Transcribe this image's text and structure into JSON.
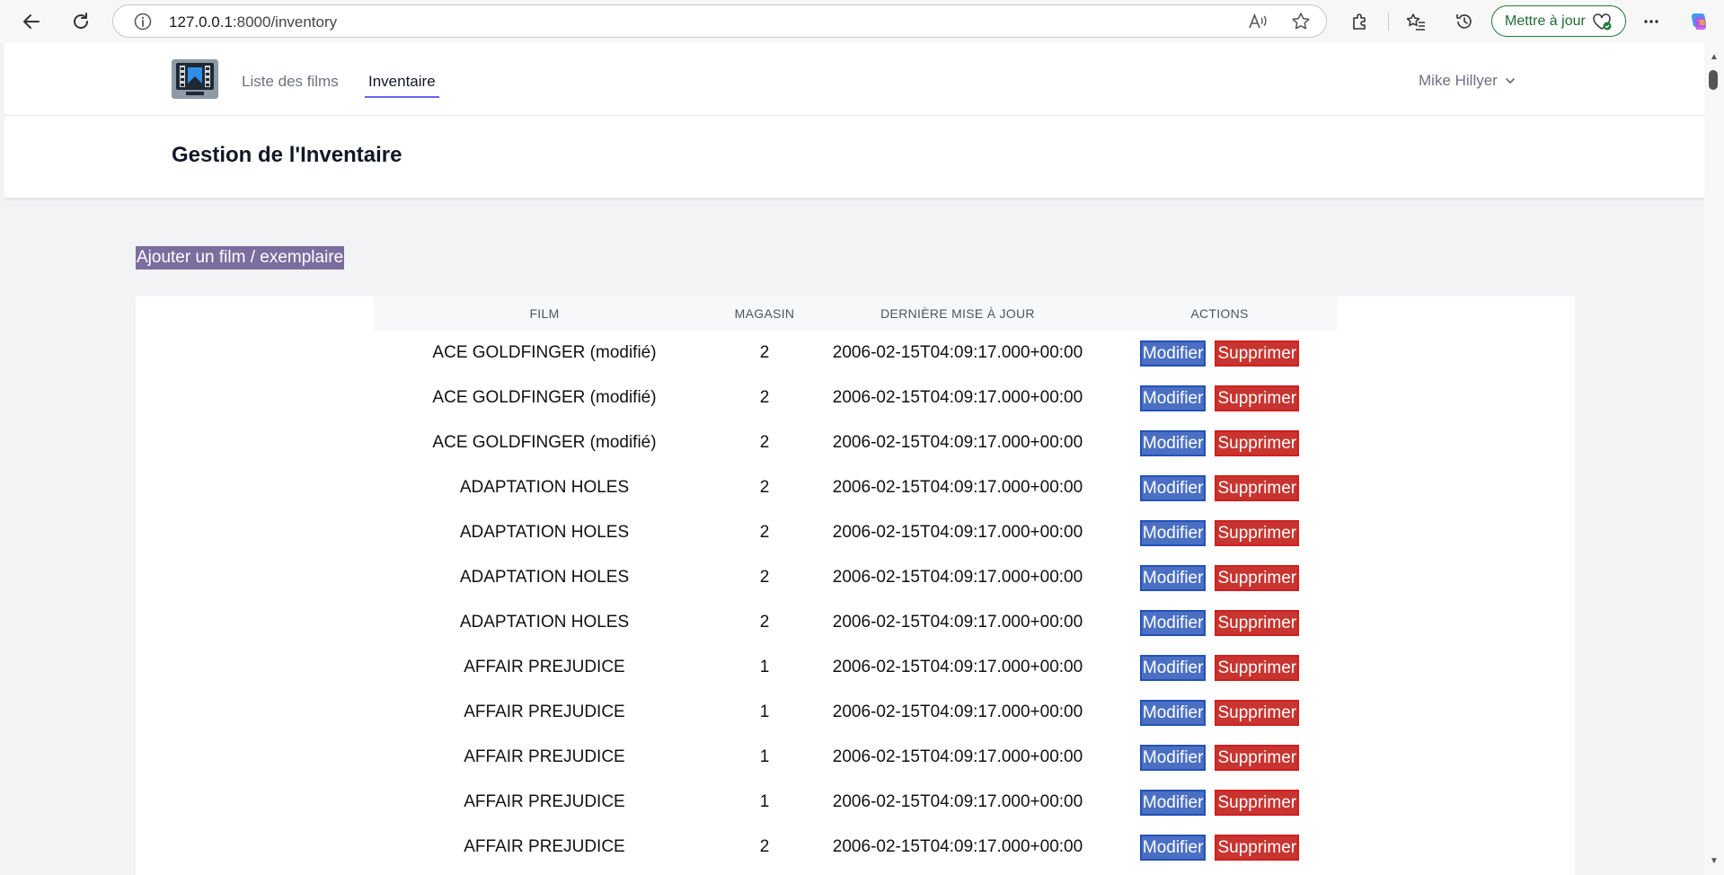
{
  "browser": {
    "url_host": "127.0.0.1",
    "url_path": ":8000/inventory",
    "update_label": "Mettre à jour"
  },
  "nav": {
    "links": [
      {
        "label": "Liste des films"
      },
      {
        "label": "Inventaire"
      }
    ],
    "user": "Mike Hillyer"
  },
  "page": {
    "title": "Gestion de l'Inventaire",
    "add_link": "Ajouter un film / exemplaire"
  },
  "table": {
    "headers": [
      "FILM",
      "MAGASIN",
      "DERNIÈRE MISE À JOUR",
      "ACTIONS"
    ],
    "edit_label": "Modifier",
    "delete_label": "Supprimer",
    "rows": [
      {
        "film": "ACE GOLDFINGER (modifié)",
        "store": "2",
        "updated": "2006-02-15T04:09:17.000+00:00"
      },
      {
        "film": "ACE GOLDFINGER (modifié)",
        "store": "2",
        "updated": "2006-02-15T04:09:17.000+00:00"
      },
      {
        "film": "ACE GOLDFINGER (modifié)",
        "store": "2",
        "updated": "2006-02-15T04:09:17.000+00:00"
      },
      {
        "film": "ADAPTATION HOLES",
        "store": "2",
        "updated": "2006-02-15T04:09:17.000+00:00"
      },
      {
        "film": "ADAPTATION HOLES",
        "store": "2",
        "updated": "2006-02-15T04:09:17.000+00:00"
      },
      {
        "film": "ADAPTATION HOLES",
        "store": "2",
        "updated": "2006-02-15T04:09:17.000+00:00"
      },
      {
        "film": "ADAPTATION HOLES",
        "store": "2",
        "updated": "2006-02-15T04:09:17.000+00:00"
      },
      {
        "film": "AFFAIR PREJUDICE",
        "store": "1",
        "updated": "2006-02-15T04:09:17.000+00:00"
      },
      {
        "film": "AFFAIR PREJUDICE",
        "store": "1",
        "updated": "2006-02-15T04:09:17.000+00:00"
      },
      {
        "film": "AFFAIR PREJUDICE",
        "store": "1",
        "updated": "2006-02-15T04:09:17.000+00:00"
      },
      {
        "film": "AFFAIR PREJUDICE",
        "store": "1",
        "updated": "2006-02-15T04:09:17.000+00:00"
      },
      {
        "film": "AFFAIR PREJUDICE",
        "store": "2",
        "updated": "2006-02-15T04:09:17.000+00:00"
      }
    ]
  }
}
